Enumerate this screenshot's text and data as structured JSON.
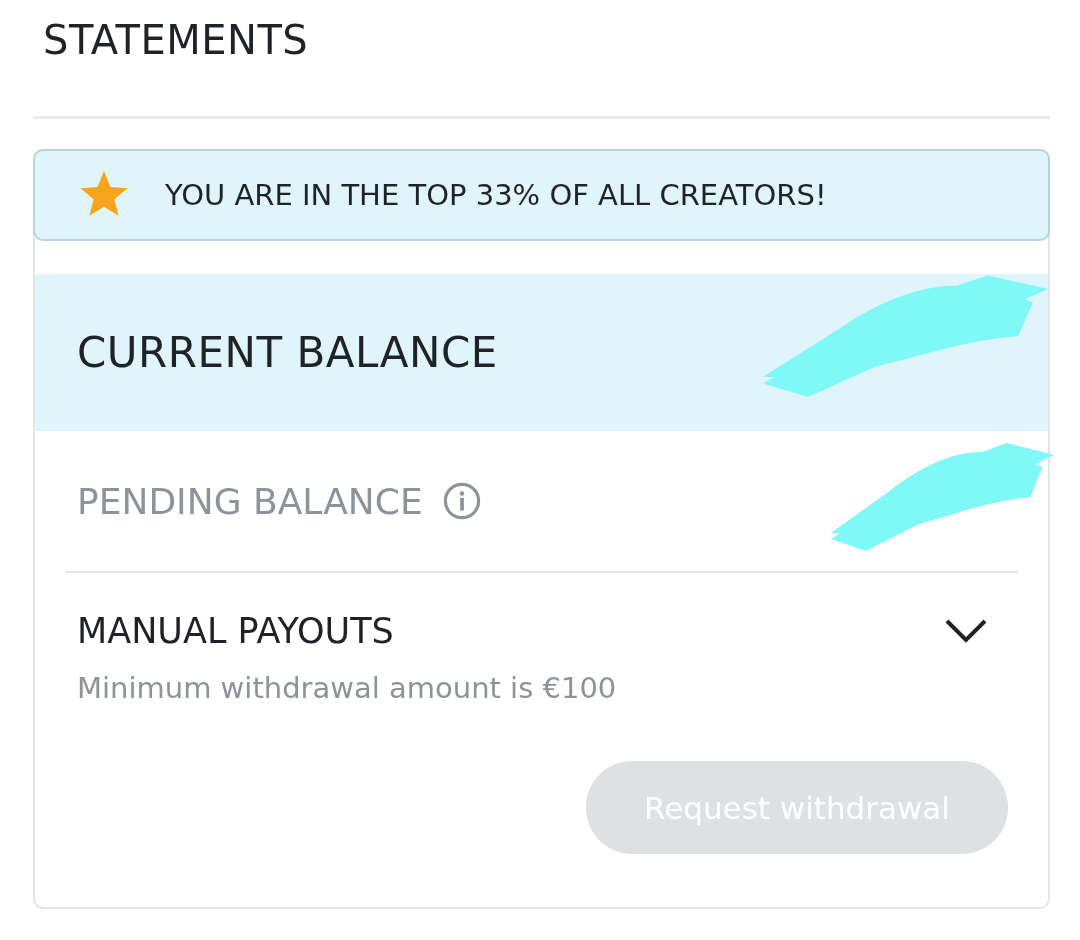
{
  "header": {
    "title": "STATEMENTS"
  },
  "banner": {
    "text": "YOU ARE IN THE TOP 33% OF ALL CREATORS!"
  },
  "current_balance": {
    "label": "CURRENT BALANCE",
    "redacted": true
  },
  "pending_balance": {
    "label": "PENDING BALANCE",
    "redacted": true
  },
  "manual_payouts": {
    "title": "MANUAL PAYOUTS",
    "expanded": false,
    "note": "Minimum withdrawal amount is €100"
  },
  "withdraw_button": {
    "label": "Request withdrawal",
    "disabled": true
  }
}
